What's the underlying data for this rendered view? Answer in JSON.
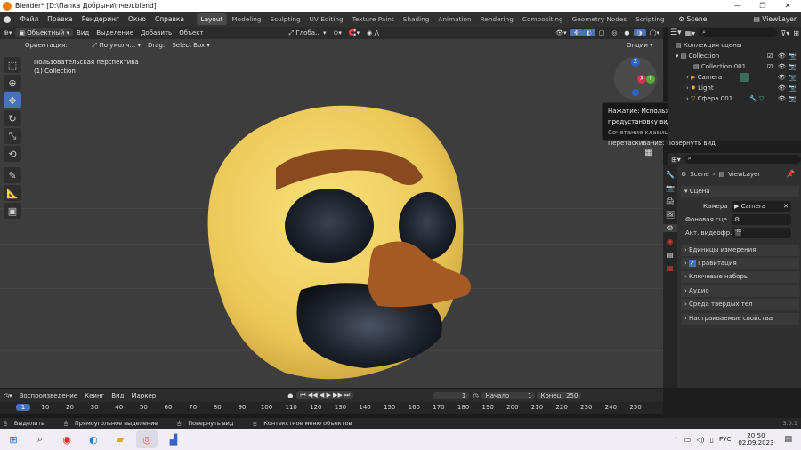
{
  "window": {
    "title": "Blender* [D:\\Папка Добрыни\\пчел.blend]",
    "minimize": "—",
    "maximize": "❐",
    "close": "✕"
  },
  "menu": {
    "items": [
      "Файл",
      "Правка",
      "Рендеринг",
      "Окно",
      "Справка"
    ],
    "workspaces": [
      "Layout",
      "Modeling",
      "Sculpting",
      "UV Editing",
      "Texture Paint",
      "Shading",
      "Animation",
      "Rendering",
      "Compositing",
      "Geometry Nodes",
      "Scripting"
    ],
    "active_workspace": "Layout",
    "scene": "Scene",
    "view_layer": "ViewLayer"
  },
  "viewport_header": {
    "mode": "Объектный",
    "menus": [
      "Вид",
      "Выделение",
      "Добавить",
      "Объект"
    ],
    "transform": "Глоба...",
    "orientation_label": "Ориентация:",
    "orientation_value": "По умолч...",
    "drag_label": "Drag:",
    "drag_value": "Select Box",
    "options": "Опции"
  },
  "viewport": {
    "view_name": "Пользовательская перспектива",
    "collection": "(1) Collection",
    "gizmo_axes": [
      "Z",
      "Y",
      "X"
    ]
  },
  "tooltip": {
    "line1": "Нажатие: Использовать предустановку вида",
    "line2": "Сочетание клавиш: Numpad 3",
    "line3": "Перетаскивание: Повернуть вид"
  },
  "outliner": {
    "root": "Коллекция сцены",
    "items": [
      {
        "label": "Collection"
      },
      {
        "label": "Collection.001"
      },
      {
        "label": "Camera"
      },
      {
        "label": "Light"
      },
      {
        "label": "Сфера.001"
      }
    ]
  },
  "properties": {
    "breadcrumb_scene": "Scene",
    "breadcrumb_layer": "ViewLayer",
    "section_scene": "Сцена",
    "camera_label": "Камера",
    "camera_value": "Camera",
    "bg_scene_label": "Фоновая сце...",
    "active_clip_label": "Акт. видеофр.",
    "sections": [
      "Единицы измерения",
      "Гравитация",
      "Ключевые наборы",
      "Аудио",
      "Среда твёрдых тел",
      "Настраиваемые свойства"
    ]
  },
  "timeline": {
    "menus": [
      "Воспроизведение",
      "Кеинг",
      "Вид",
      "Маркер"
    ],
    "current_frame": "1",
    "start_label": "Начало",
    "start_value": "1",
    "end_label": "Конец",
    "end_value": "250",
    "ticks": [
      "1",
      "10",
      "20",
      "30",
      "40",
      "50",
      "60",
      "70",
      "80",
      "90",
      "100",
      "110",
      "120",
      "130",
      "140",
      "150",
      "160",
      "170",
      "180",
      "190",
      "200",
      "210",
      "220",
      "230",
      "240",
      "250"
    ]
  },
  "statusbar": {
    "select": "Выделить",
    "box_select": "Прямоугольное выделение",
    "rotate": "Повернуть вид",
    "context_menu": "Контекстное меню объектов",
    "version": "3.0.1"
  },
  "taskbar": {
    "lang": "РУС",
    "time": "20:50",
    "date": "02.09.2023"
  },
  "colors": {
    "accent": "#4772b3",
    "head_yellow": "#f1d56a",
    "brown": "#8a4a1f"
  }
}
